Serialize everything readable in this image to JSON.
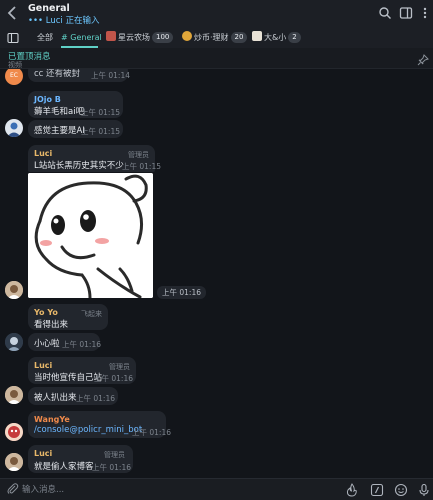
{
  "header": {
    "title": "General",
    "typing": "Luci 正在输入"
  },
  "tabs": [
    {
      "label": "全部"
    },
    {
      "label": "# General"
    },
    {
      "label": "星云农场",
      "count": "100"
    },
    {
      "label": "炒币·理财",
      "count": "20"
    },
    {
      "label": "大&小",
      "count": "2"
    }
  ],
  "pinned": {
    "title": "已置顶消息",
    "subtitle": "视频"
  },
  "messages": [
    {
      "text": "cc 还有被封",
      "time": "上午 01:14"
    },
    {
      "sender": "JOjo B",
      "text": "薅羊毛和ai吧",
      "time": "上午 01:15"
    },
    {
      "text": "感觉主要是AI",
      "time": "上午 01:15"
    },
    {
      "sender": "Luci",
      "role": "管理员",
      "text": "L站站长黑历史其实不少",
      "time": "上午 01:15"
    },
    {
      "time": "上午 01:16"
    },
    {
      "sender": "Yo Yo",
      "role": "飞起来",
      "text": "看得出来",
      "time": "上午 01:16"
    },
    {
      "text": "小心啦",
      "time": "上午 01:16"
    },
    {
      "sender": "Luci",
      "role": "管理员",
      "text": "当时他宣传自己站",
      "time": "上午 01:16"
    },
    {
      "text": "被人扒出来",
      "time": "上午 01:16"
    },
    {
      "sender": "WangYe",
      "text": "/console@policr_mini_bot",
      "time": "上午 01:16"
    },
    {
      "sender": "Luci",
      "role": "管理员",
      "text": "就是偷人家博客",
      "time": "上午 01:16"
    }
  ],
  "composer": {
    "placeholder": "输入消息..."
  },
  "colors": {
    "accent": "#5fd0c6",
    "sender_luci": "#e8b86a",
    "sender_jojo": "#6cb7ff",
    "sender_yoyo": "#e8b86a",
    "sender_wangye": "#f08a4b"
  }
}
